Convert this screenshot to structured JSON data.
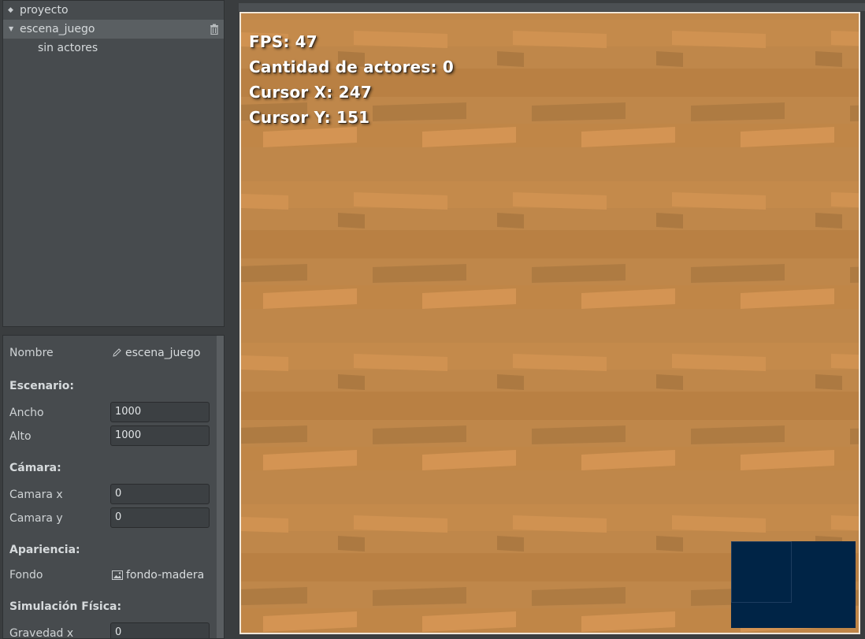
{
  "tree": {
    "project_label": "proyecto",
    "scene_label": "escena_juego",
    "child_label": "sin actores"
  },
  "properties": {
    "name_label": "Nombre",
    "name_value": "escena_juego",
    "section_stage": "Escenario:",
    "width_label": "Ancho",
    "width_value": "1000",
    "height_label": "Alto",
    "height_value": "1000",
    "section_camera": "Cámara:",
    "camera_x_label": "Camara x",
    "camera_x_value": "0",
    "camera_y_label": "Camara y",
    "camera_y_value": "0",
    "section_appearance": "Apariencia:",
    "background_label": "Fondo",
    "background_value": "fondo-madera",
    "section_physics": "Simulación Física:",
    "gravity_x_label": "Gravedad x",
    "gravity_x_value": "0"
  },
  "hud": {
    "fps": "FPS: 47",
    "actors": "Cantidad de actores: 0",
    "cursor_x": "Cursor X: 247",
    "cursor_y": "Cursor Y: 151"
  },
  "colors": {
    "wood_base": "#bf874a",
    "wood_plank_light": "#cf8f4d",
    "wood_plank_dark": "#a87740",
    "minimap": "#002446",
    "selected_row": "#5a5f62"
  },
  "icons": {
    "project": "diamond-icon",
    "scene": "triangle-down-icon",
    "delete": "trash-icon",
    "edit": "pencil-icon",
    "image": "image-icon"
  }
}
